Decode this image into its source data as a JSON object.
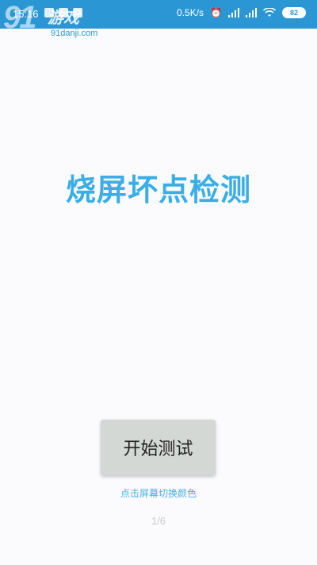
{
  "status_bar": {
    "time": "15:16",
    "network_speed": "0.5K/s",
    "alarm_icon": "alarm-icon",
    "signal_icons": [
      "signal-icon",
      "signal-icon"
    ],
    "wifi_icon": "wifi-icon",
    "battery": "82",
    "background": "#2a97d4"
  },
  "watermark": {
    "number": "91",
    "brand": "游戏",
    "url": "91danji.com"
  },
  "main": {
    "title": "烧屏坏点检测",
    "title_color": "#3aaee6",
    "start_button_label": "开始测试",
    "hint": "点击屏幕切换颜色",
    "page_indicator": "1/6"
  }
}
